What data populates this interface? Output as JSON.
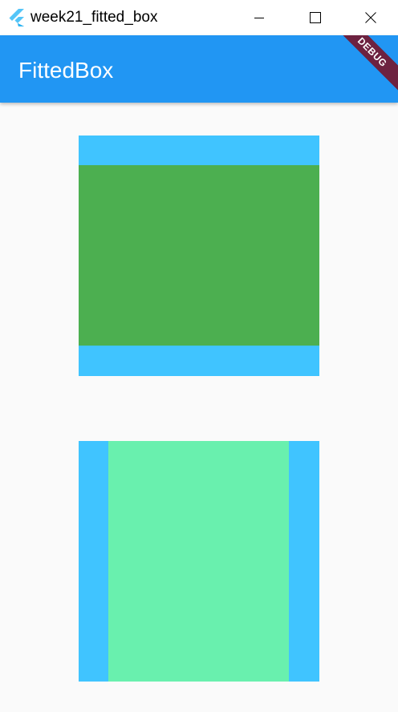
{
  "window": {
    "title": "week21_fitted_box",
    "icon": "flutter-logo-icon"
  },
  "controls": {
    "minimize_icon": "minimize-icon",
    "maximize_icon": "maximize-icon",
    "close_icon": "close-icon"
  },
  "appbar": {
    "title": "FittedBox",
    "color": "#2196f3"
  },
  "debug_banner": {
    "label": "DEBUG",
    "color": "#6d2240"
  },
  "boxes": [
    {
      "outer_color": "#40c4ff",
      "inner_color": "#4caf50"
    },
    {
      "outer_color": "#40c4ff",
      "inner_color": "#69f0ae"
    }
  ]
}
